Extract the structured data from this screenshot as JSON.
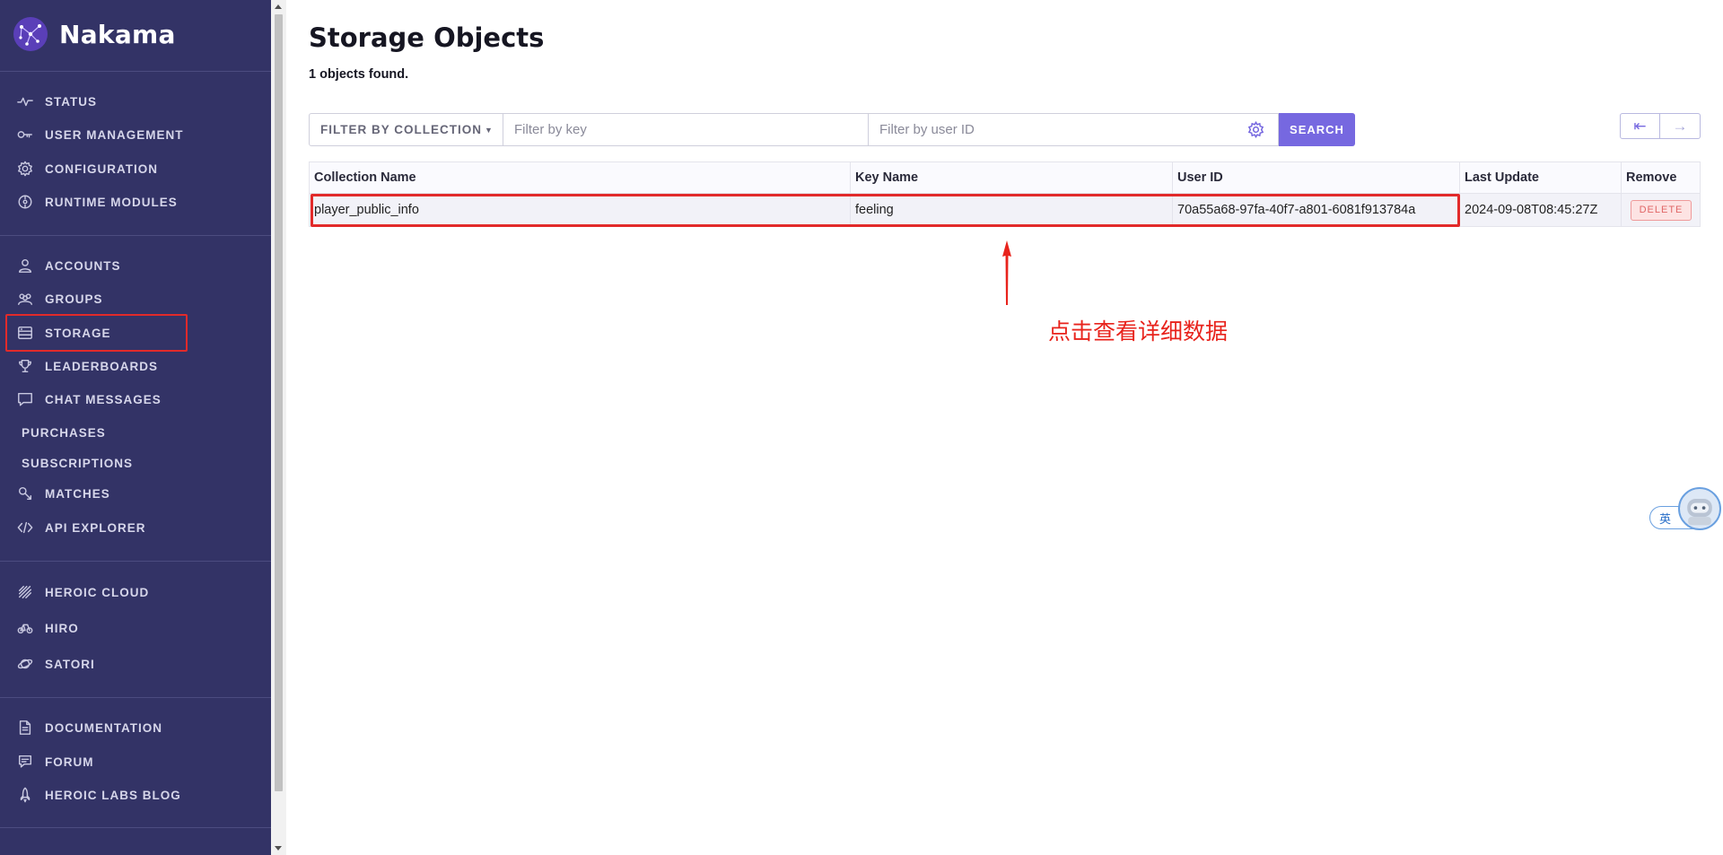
{
  "app": {
    "name": "Nakama"
  },
  "sidebar": {
    "group1": [
      {
        "label": "STATUS",
        "icon": "pulse-icon"
      },
      {
        "label": "USER MANAGEMENT",
        "icon": "key-icon"
      },
      {
        "label": "CONFIGURATION",
        "icon": "gear-icon"
      },
      {
        "label": "RUNTIME MODULES",
        "icon": "module-icon"
      }
    ],
    "group2": [
      {
        "label": "ACCOUNTS",
        "icon": "user-icon"
      },
      {
        "label": "GROUPS",
        "icon": "group-icon"
      },
      {
        "label": "STORAGE",
        "icon": "storage-icon",
        "active": true
      },
      {
        "label": "LEADERBOARDS",
        "icon": "trophy-icon"
      },
      {
        "label": "CHAT MESSAGES",
        "icon": "chat-icon"
      },
      {
        "label": "PURCHASES"
      },
      {
        "label": "SUBSCRIPTIONS"
      },
      {
        "label": "MATCHES",
        "icon": "match-icon"
      },
      {
        "label": "API EXPLORER",
        "icon": "code-icon"
      }
    ],
    "group3": [
      {
        "label": "HEROIC CLOUD",
        "icon": "cloud-icon"
      },
      {
        "label": "HIRO",
        "icon": "hiro-icon"
      },
      {
        "label": "SATORI",
        "icon": "satori-icon"
      }
    ],
    "group4": [
      {
        "label": "DOCUMENTATION",
        "icon": "document-icon"
      },
      {
        "label": "FORUM",
        "icon": "forum-icon"
      },
      {
        "label": "HEROIC LABS BLOG",
        "icon": "rocket-icon"
      }
    ]
  },
  "main": {
    "title": "Storage Objects",
    "found_text": "1 objects found.",
    "filter": {
      "collection_label": "FILTER BY COLLECTION",
      "key_placeholder": "Filter by key",
      "user_placeholder": "Filter by user ID",
      "search_label": "SEARCH"
    },
    "pager": {
      "first": "⇤",
      "next": "→"
    },
    "table": {
      "columns": [
        "Collection Name",
        "Key Name",
        "User ID",
        "Last Update",
        "Remove"
      ],
      "rows": [
        {
          "collection": "player_public_info",
          "key": "feeling",
          "user_id": "70a55a68-97fa-40f7-a801-6081f913784a",
          "last_update": "2024-09-08T08:45:27Z",
          "action": "DELETE"
        }
      ]
    }
  },
  "annotation": {
    "text": "点击查看详细数据",
    "color": "#e8231c"
  },
  "ime": {
    "label": "英"
  },
  "colors": {
    "sidebar": "#333366",
    "accent": "#7668e0",
    "highlight": "#e22a2a"
  }
}
